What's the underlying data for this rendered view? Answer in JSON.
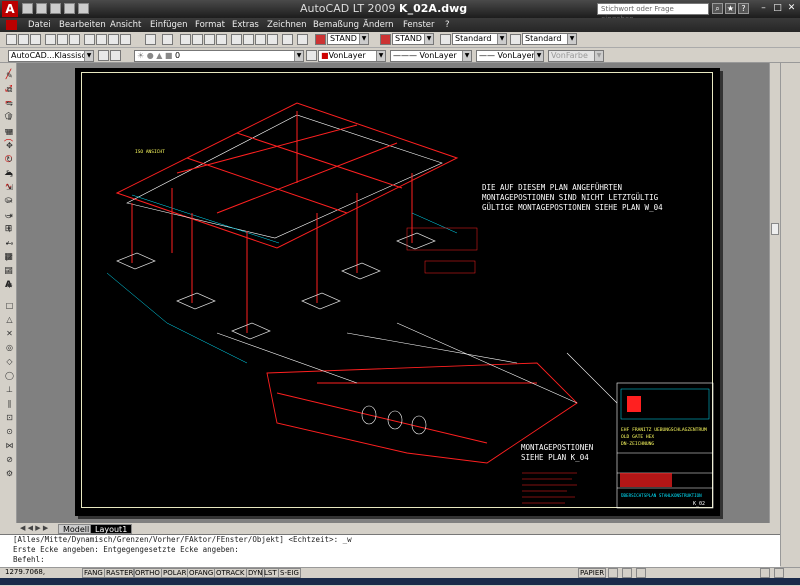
{
  "window": {
    "title_prefix": "AutoCAD LT 2009 ",
    "title_file": "K_02A.dwg",
    "logo": "A"
  },
  "search": {
    "placeholder": "Stichwort oder Frage eingeben"
  },
  "menu": [
    "Datei",
    "Bearbeiten",
    "Ansicht",
    "Einfügen",
    "Format",
    "Extras",
    "Zeichnen",
    "Bemaßung",
    "Ändern",
    "Fenster",
    "?"
  ],
  "toolbar1": {
    "textstyle": "STAND",
    "dimstyle": "STAND",
    "tablestyle": "Standard",
    "mleaderstyle": "Standard"
  },
  "toolbar2": {
    "workspace": "AutoCAD...Klassisc",
    "layer": "0",
    "color": "VonLayer",
    "linetype": "VonLayer",
    "lineweight": "VonLayer",
    "plotstyle": "VonFarbe"
  },
  "drawing": {
    "note_lines": [
      "DIE AUF DIESEM PLAN ANGEFÜHRTEN",
      "MONTAGEPOSTIONEN SIND NICHT LETZTGÜLTIG",
      "GÜLTIGE MONTAGEPOSTIONEN SIEHE PLAN W_04"
    ],
    "note2_lines": [
      "MONTAGEPOSTIONEN",
      "SIEHE PLAN K_04"
    ],
    "iso_label": "ISO ANSICHT",
    "title_company": "EHF FRANITZ  UEBUNGSCHLAGZENTRUM",
    "title_project": "OLD GATE HEX",
    "title_sub": "DN-ZEICHNUNG",
    "title_drawing": "ÜBERSICHTSPLAN STAHLKONSTRUKTION",
    "title_number": "K_02"
  },
  "layout_tabs": {
    "model": "Modell",
    "layout": "Layout1"
  },
  "command": {
    "line1": "[Alles/Mitte/Dynamisch/Grenzen/Vorher/FAktor/FEnster/Objekt] <Echtzeit>: _w",
    "line2": "Erste Ecke angeben: Entgegengesetzte Ecke angeben:",
    "prompt": "Befehl:"
  },
  "status": {
    "coords": "1279.7068, 586.4017",
    "toggles": [
      "FANG",
      "RASTER",
      "ORTHO",
      "POLAR",
      "OFANG",
      "OTRACK",
      "DYN",
      "LST",
      "S-EIG"
    ],
    "paper": "PAPIER"
  },
  "colors": {
    "structure": "#ff2020",
    "dims": "#00e5ff",
    "white": "#ffffff",
    "titlebar": "#1c1c1c"
  }
}
